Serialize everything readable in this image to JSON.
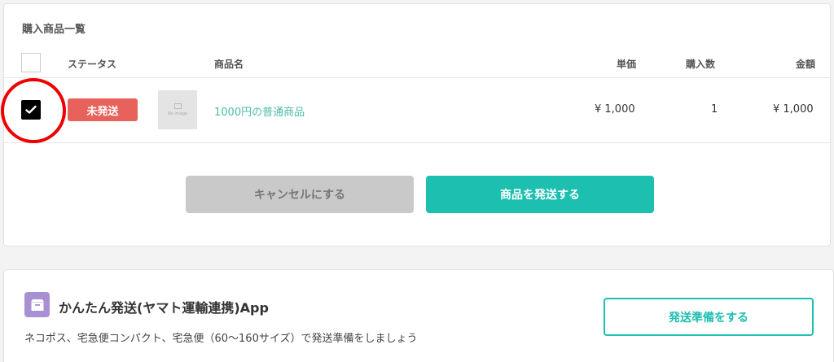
{
  "purchased_items": {
    "title": "購入商品一覧",
    "columns": {
      "status": "ステータス",
      "product_name": "商品名",
      "unit_price": "単価",
      "quantity": "購入数",
      "amount": "金額"
    },
    "rows": [
      {
        "checked": true,
        "status": "未発送",
        "thumbnail_caption": "No image",
        "product_name": "1000円の普通商品",
        "unit_price": "¥ 1,000",
        "quantity": "1",
        "amount": "¥ 1,000"
      }
    ],
    "actions": {
      "cancel_label": "キャンセルにする",
      "ship_label": "商品を発送する"
    }
  },
  "shipping_app": {
    "title": "かんたん発送(ヤマト運輸連携)App",
    "description": "ネコポス、宅急便コンパクト、宅急便（60〜160サイズ）で発送準備をしましょう",
    "button_label": "発送準備をする",
    "icon": "box-icon"
  },
  "colors": {
    "accent": "#1dbfb0",
    "status_unshipped": "#e8625c",
    "annotation_circle": "#ee0000",
    "app_icon_bg": "#a990d2"
  }
}
